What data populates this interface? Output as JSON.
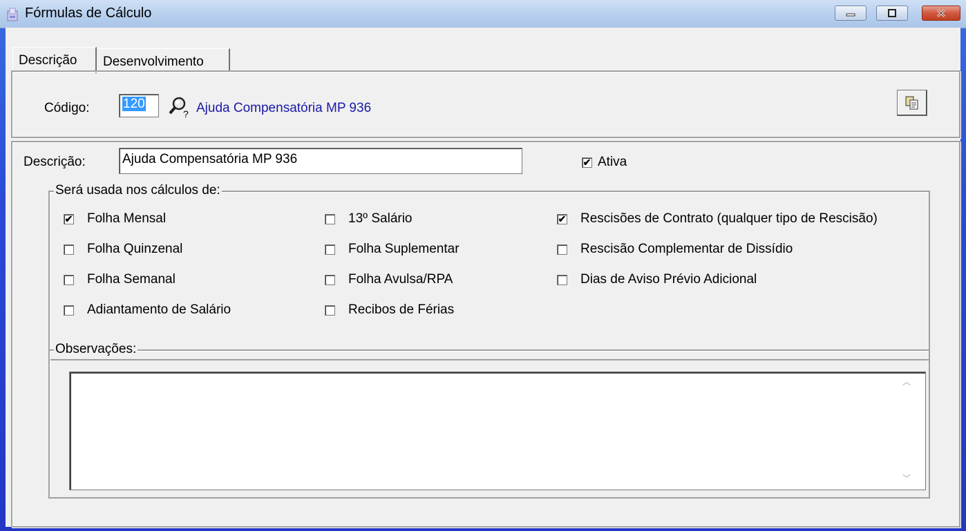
{
  "window": {
    "title": "Fórmulas de Cálculo",
    "icon": "form-app-icon"
  },
  "tabs": [
    {
      "label": "Descrição",
      "active": true
    },
    {
      "label": "Desenvolvimento",
      "active": false
    }
  ],
  "code_section": {
    "label": "Código:",
    "value": "120",
    "description": "Ajuda Compensatória MP 936",
    "search_icon": "magnifier-question-icon",
    "copy_icon": "copy-icon"
  },
  "form": {
    "description_label": "Descrição:",
    "description_value": "Ajuda Compensatória MP 936",
    "active_label": "Ativa",
    "active_checked": true
  },
  "calc_group": {
    "legend": "Será usada nos cálculos de:",
    "options": [
      {
        "label": "Folha Mensal",
        "checked": true
      },
      {
        "label": "Folha Quinzenal",
        "checked": false
      },
      {
        "label": "Folha Semanal",
        "checked": false
      },
      {
        "label": "Adiantamento de Salário",
        "checked": false
      },
      {
        "label": "13º Salário",
        "checked": false
      },
      {
        "label": "Folha Suplementar",
        "checked": false
      },
      {
        "label": "Folha Avulsa/RPA",
        "checked": false
      },
      {
        "label": "Recibos de Férias",
        "checked": false
      },
      {
        "label": "Rescisões de Contrato (qualquer tipo de Rescisão)",
        "checked": true
      },
      {
        "label": "Rescisão Complementar de Dissídio",
        "checked": false
      },
      {
        "label": "Dias de Aviso Prévio Adicional",
        "checked": false
      }
    ]
  },
  "observations": {
    "legend": "Observações:",
    "value": ""
  }
}
